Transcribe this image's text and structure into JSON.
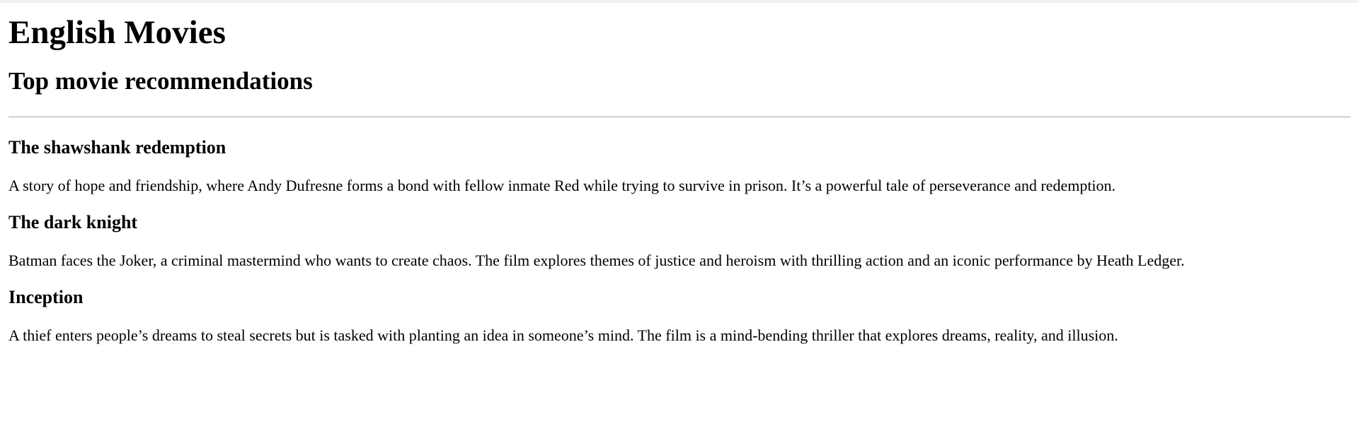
{
  "page": {
    "title": "English Movies",
    "subtitle": "Top movie recommendations"
  },
  "movies": [
    {
      "title": "The shawshank redemption",
      "description": "A story of hope and friendship, where Andy Dufresne forms a bond with fellow inmate Red while trying to survive in prison. It’s a powerful tale of perseverance and redemption."
    },
    {
      "title": "The dark knight",
      "description": "Batman faces the Joker, a criminal mastermind who wants to create chaos. The film explores themes of justice and heroism with thrilling action and an iconic performance by Heath Ledger."
    },
    {
      "title": "Inception",
      "description": "A thief enters people’s dreams to steal secrets but is tasked with planting an idea in someone’s mind. The film is a mind-bending thriller that explores dreams, reality, and illusion."
    }
  ]
}
